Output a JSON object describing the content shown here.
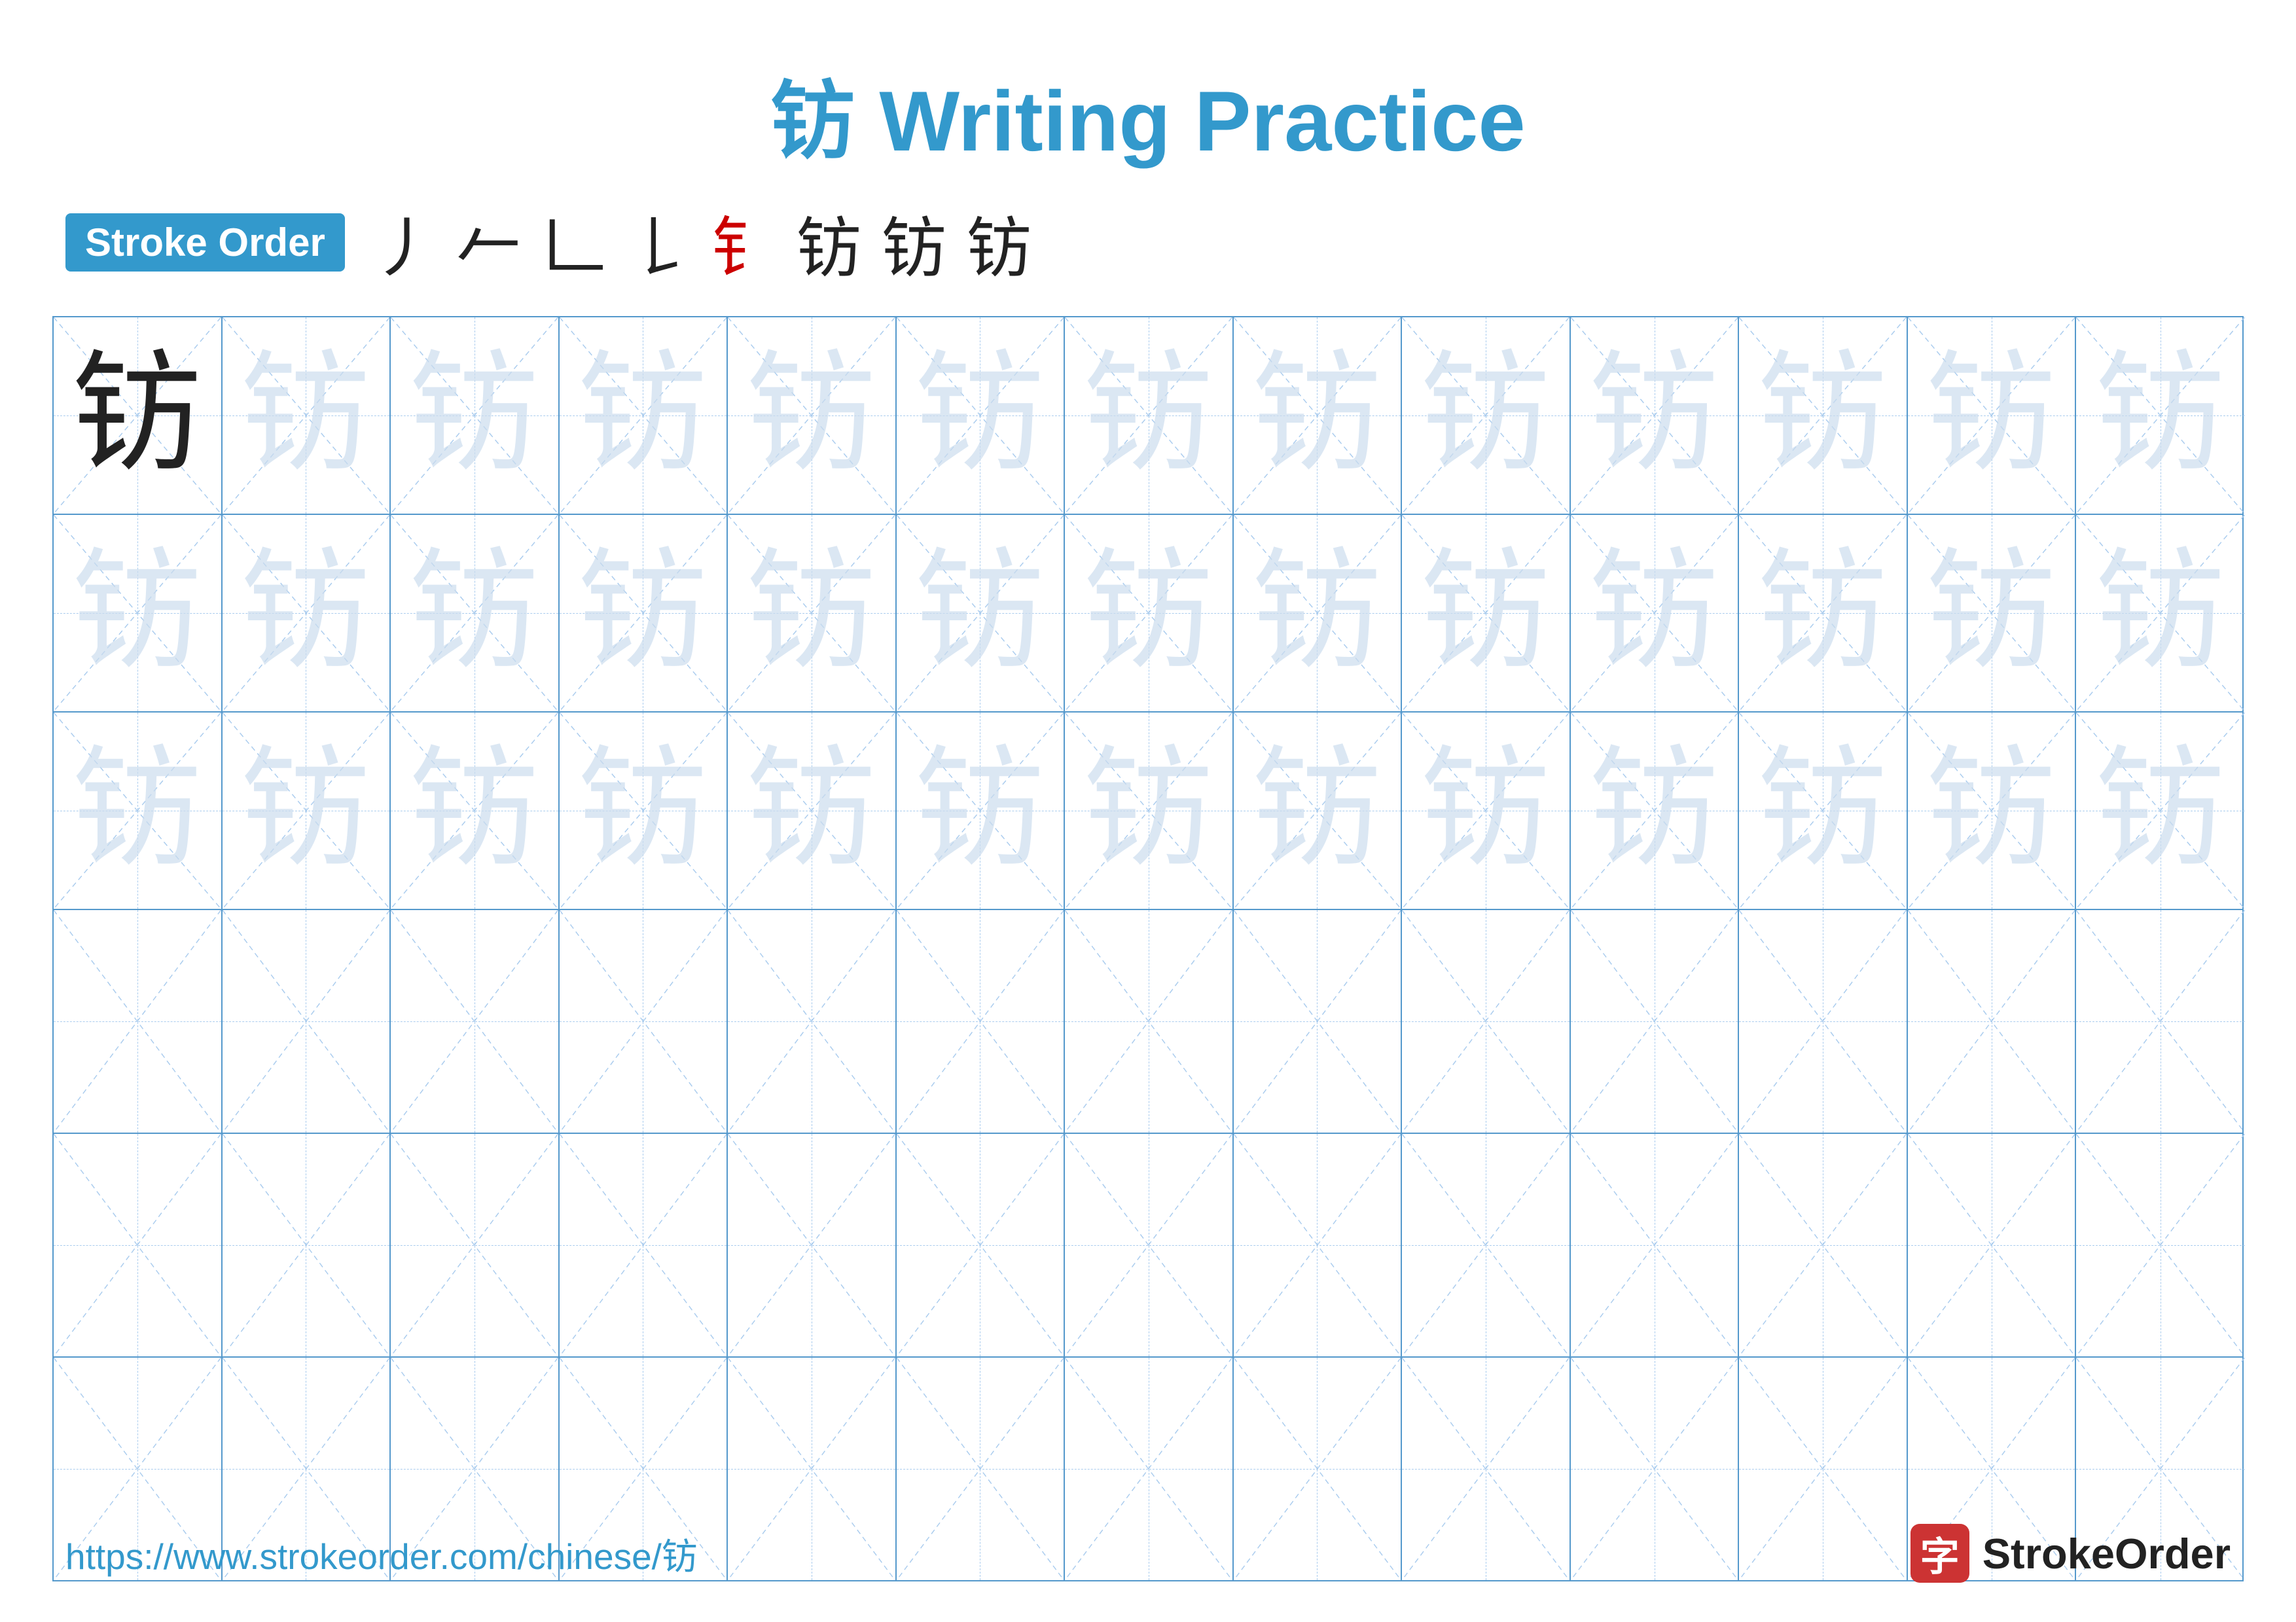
{
  "title": {
    "char": "钫",
    "label": "Writing Practice",
    "full": "钫 Writing Practice"
  },
  "stroke_order": {
    "badge_label": "Stroke Order",
    "strokes": [
      "丿",
      "𠂉",
      "𠃊",
      "𠃊",
      "钅",
      "钫̶",
      "钫̶",
      "钫"
    ]
  },
  "grid": {
    "char": "钫",
    "rows": 6,
    "cols": 13,
    "char_rows_filled": 3,
    "char_rows_empty": 3
  },
  "footer": {
    "url": "https://www.strokeorder.com/chinese/钫",
    "logo_char": "字",
    "logo_text": "StrokeOrder"
  }
}
